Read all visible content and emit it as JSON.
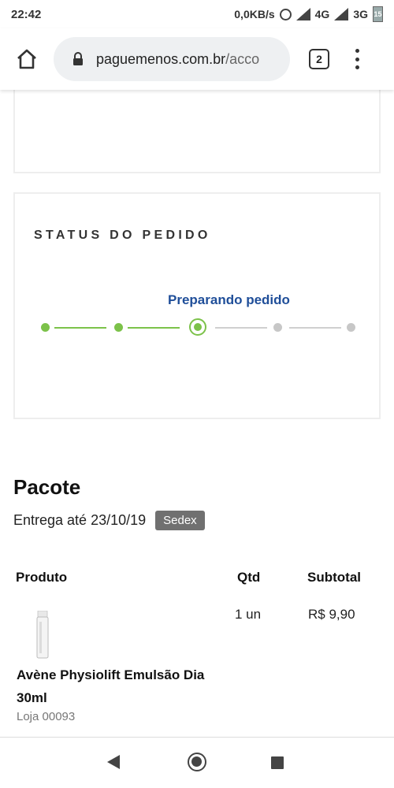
{
  "status_bar": {
    "time": "22:42",
    "net_speed": "0,0KB/s",
    "net1": "4G",
    "net2": "3G",
    "battery": "15"
  },
  "browser": {
    "url_main": "paguemenos.com.br",
    "url_rest": "/acco",
    "tab_count": "2",
    "icons": [
      "home-icon",
      "lock-icon",
      "menu-icon"
    ]
  },
  "order_status": {
    "title": "STATUS DO PEDIDO",
    "current_step_label": "Preparando pedido",
    "steps_total": 5,
    "current_step_index": 3,
    "colors": {
      "done": "#7cc24a",
      "todo": "#c7c7c7",
      "label": "#1f4e99"
    }
  },
  "package": {
    "title": "Pacote",
    "delivery_text": "Entrega até 23/10/19",
    "shipping_badge": "Sedex",
    "table": {
      "headers": [
        "Produto",
        "Qtd",
        "Subtotal"
      ],
      "rows": [
        {
          "product_name": "Avène Physiolift Emulsão Dia 30ml",
          "store": "Loja 00093",
          "qty": "1 un",
          "subtotal": "R$ 9,90"
        }
      ]
    }
  },
  "nav": {
    "icons": [
      "back-icon",
      "home-circle-icon",
      "recents-icon"
    ]
  }
}
